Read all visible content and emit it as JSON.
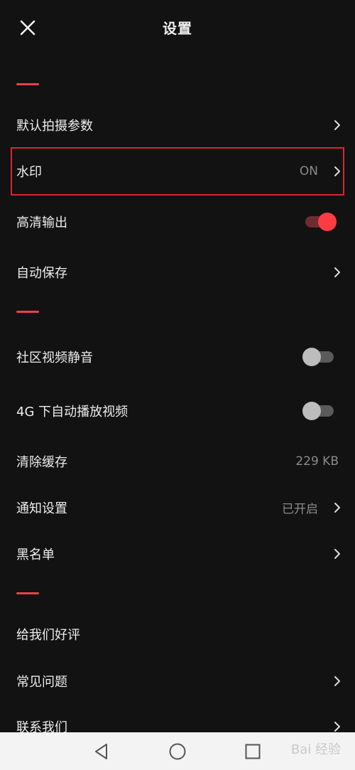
{
  "header": {
    "title": "设置",
    "close_icon": "close-icon"
  },
  "section1": {
    "items": [
      {
        "label": "默认拍摄参数",
        "value": ""
      },
      {
        "label": "水印",
        "value": "ON"
      },
      {
        "label": "高清输出",
        "toggle": "on"
      },
      {
        "label": "自动保存",
        "value": ""
      }
    ]
  },
  "section2": {
    "items": [
      {
        "label": "社区视频静音",
        "toggle": "off"
      },
      {
        "label": "4G 下自动播放视频",
        "toggle": "off"
      },
      {
        "label": "清除缓存",
        "value": "229 KB"
      },
      {
        "label": "通知设置",
        "value": "已开启"
      },
      {
        "label": "黑名单",
        "value": ""
      }
    ]
  },
  "section3": {
    "items": [
      {
        "label": "给我们好评"
      },
      {
        "label": "常见问题"
      },
      {
        "label": "联系我们"
      }
    ]
  },
  "navbar": {
    "back_icon": "back-triangle-icon",
    "home_icon": "home-circle-icon",
    "recents_icon": "recents-square-icon",
    "watermark_text": "Bai 经验"
  },
  "colors": {
    "background": "#121212",
    "accent": "#e8424a",
    "toggle_on": "#ff3b44",
    "text": "#ededed",
    "secondary": "#8a8a8a"
  }
}
